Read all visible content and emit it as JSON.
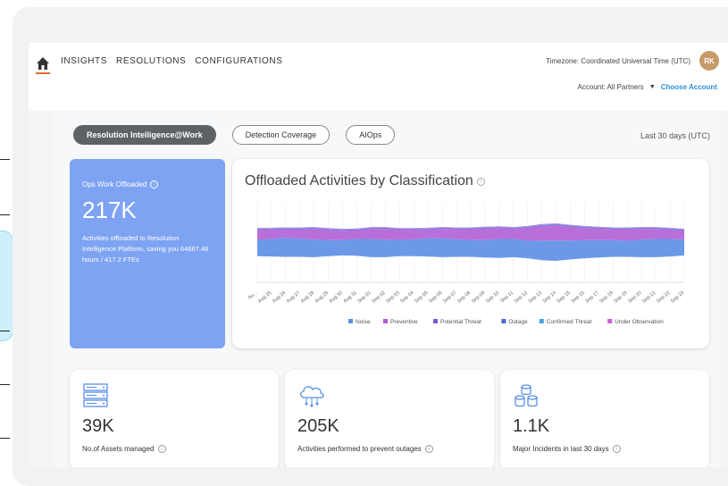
{
  "nav": {
    "links": [
      "INSIGHTS",
      "RESOLUTIONS",
      "CONFIGURATIONS"
    ],
    "timezone": "Timezone: Coordinated Universal Time (UTC)",
    "avatar_initials": "RK",
    "account_label": "Account: All Partners",
    "choose_account": "Choose Account"
  },
  "tabs": [
    "Resolution Intelligence@Work",
    "Detection Coverage",
    "AIOps"
  ],
  "time_range": "Last 30 days (UTC)",
  "ops_card": {
    "title": "Ops Work Offloaded",
    "value": "217K",
    "description": "Activities offloaded to Resolution Intelligence Platform, saving you 64667.46 hours / 417.2 FTEs"
  },
  "chart_data": {
    "type": "area",
    "title": "Offloaded Activities by Classification",
    "x": [
      "Au...",
      "Aug 25",
      "Aug 26",
      "Aug 27",
      "Aug 28",
      "Aug 29",
      "Aug 30",
      "Aug 31",
      "Sep 01",
      "Sep 02",
      "Sep 03",
      "Sep 04",
      "Sep 05",
      "Sep 06",
      "Sep 07",
      "Sep 08",
      "Sep 09",
      "Sep 10",
      "Sep 11",
      "Sep 12",
      "Sep 13",
      "Sep 14",
      "Sep 15",
      "Sep 16",
      "Sep 17",
      "Sep 18",
      "Sep 19",
      "Sep 20",
      "Sep 21",
      "Sep 22",
      "Sep 23"
    ],
    "stacked_streamgraph": true,
    "series": [
      {
        "name": "Noise",
        "color": "#5b8ee6",
        "values": [
          22,
          24,
          26,
          25,
          24,
          22,
          21,
          23,
          25,
          24,
          22,
          23,
          25,
          26,
          24,
          23,
          24,
          26,
          25,
          24,
          27,
          28,
          26,
          25,
          24,
          23,
          22,
          24,
          25,
          24,
          22
        ]
      },
      {
        "name": "Preventive",
        "color": "#b05fd6",
        "values": [
          14,
          13,
          12,
          13,
          15,
          14,
          13,
          12,
          14,
          15,
          14,
          13,
          12,
          13,
          14,
          15,
          16,
          15,
          14,
          18,
          20,
          21,
          19,
          17,
          16,
          15,
          16,
          15,
          14,
          13,
          12
        ]
      },
      {
        "name": "Potential Threat",
        "color": "#7b57d1",
        "values": [
          1,
          1,
          1,
          1,
          1,
          1,
          1,
          1,
          1,
          1,
          1,
          1,
          1,
          1,
          1,
          1,
          1,
          1,
          1,
          1,
          1,
          1,
          1,
          1,
          1,
          1,
          1,
          1,
          1,
          1,
          1
        ]
      },
      {
        "name": "Outage",
        "color": "#4a6bd4",
        "values": [
          0.5,
          0.5,
          0.5,
          0.5,
          0.5,
          0.5,
          0.5,
          0.5,
          0.5,
          0.5,
          0.5,
          0.5,
          0.5,
          0.5,
          0.5,
          0.5,
          0.5,
          0.5,
          0.5,
          0.5,
          0.5,
          0.5,
          0.5,
          0.5,
          0.5,
          0.5,
          0.5,
          0.5,
          0.5,
          0.5,
          0.5
        ]
      },
      {
        "name": "Confirmed Threat",
        "color": "#4aa3e8",
        "values": [
          0.5,
          0.5,
          0.5,
          0.5,
          0.5,
          0.5,
          0.5,
          0.5,
          0.5,
          0.5,
          0.5,
          0.5,
          0.5,
          0.5,
          0.5,
          0.5,
          0.5,
          0.5,
          0.5,
          0.5,
          0.5,
          0.5,
          0.5,
          0.5,
          0.5,
          0.5,
          0.5,
          0.5,
          0.5,
          0.5,
          0.5
        ]
      },
      {
        "name": "Under Observation",
        "color": "#c85fd0",
        "values": [
          0.5,
          0.5,
          0.5,
          0.5,
          0.5,
          0.5,
          0.5,
          0.5,
          0.5,
          0.5,
          0.5,
          0.5,
          0.5,
          0.5,
          0.5,
          0.5,
          0.5,
          0.5,
          0.5,
          0.5,
          0.5,
          0.5,
          0.5,
          0.5,
          0.5,
          0.5,
          0.5,
          0.5,
          0.5,
          0.5,
          0.5
        ]
      }
    ],
    "grid": true,
    "legend": "bottom"
  },
  "stats": [
    {
      "icon": "server-rack-icon",
      "value": "39K",
      "label": "No.of Assets managed"
    },
    {
      "icon": "cloud-network-icon",
      "value": "205K",
      "label": "Activities performed to prevent outages"
    },
    {
      "icon": "database-cluster-icon",
      "value": "1.1K",
      "label": "Major Incidents in last 30 days"
    }
  ]
}
